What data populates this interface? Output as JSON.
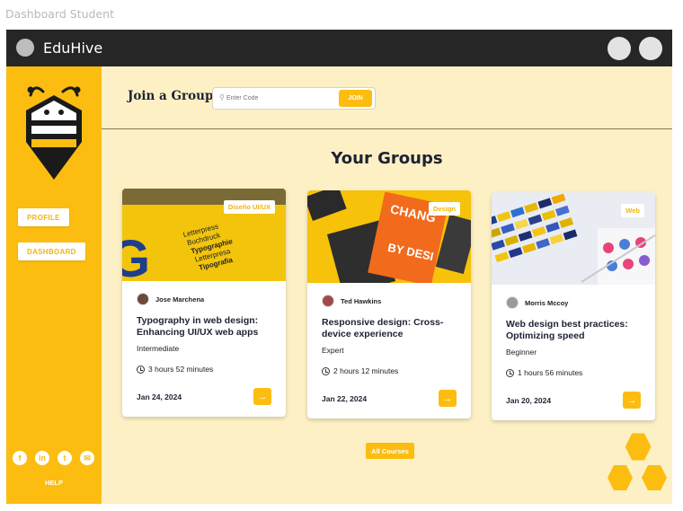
{
  "frame": {
    "label": "Dashboard Student"
  },
  "app": {
    "name": "EduHive"
  },
  "sidebar": {
    "items": [
      {
        "label": "PROFILE"
      },
      {
        "label": "DASHBOARD"
      }
    ],
    "socials": [
      "facebook-icon",
      "linkedin-icon",
      "twitter-icon",
      "email-icon"
    ],
    "help_label": "HELP"
  },
  "join": {
    "label": "Join a Group:",
    "placeholder": "Enter Code",
    "button_label": "JOIN"
  },
  "groups": {
    "title": "Your Groups",
    "cards": [
      {
        "tag": "Diseño UI/UX",
        "author": "Jose Marchena",
        "title": "Typography in web design: Enhancing UI/UX web apps",
        "level": "Intermediate",
        "duration": "3 hours 52 minutes",
        "date": "Jan 24, 2024"
      },
      {
        "tag": "Design",
        "author": "Ted Hawkins",
        "title": "Responsive design: Cross-device experience",
        "level": "Expert",
        "duration": "2 hours 12 minutes",
        "date": "Jan 22, 2024"
      },
      {
        "tag": "Web",
        "author": "Morris Mccoy",
        "title": "Web design best practices: Optimizing speed",
        "level": "Beginner",
        "duration": "1 hours 56 minutes",
        "date": "Jan 20, 2024"
      }
    ],
    "all_courses_label": "All Courses"
  },
  "colors": {
    "accent": "#fcbd10",
    "topbar": "#262626",
    "background": "#fdf0c5",
    "text_dark": "#1e2233"
  }
}
